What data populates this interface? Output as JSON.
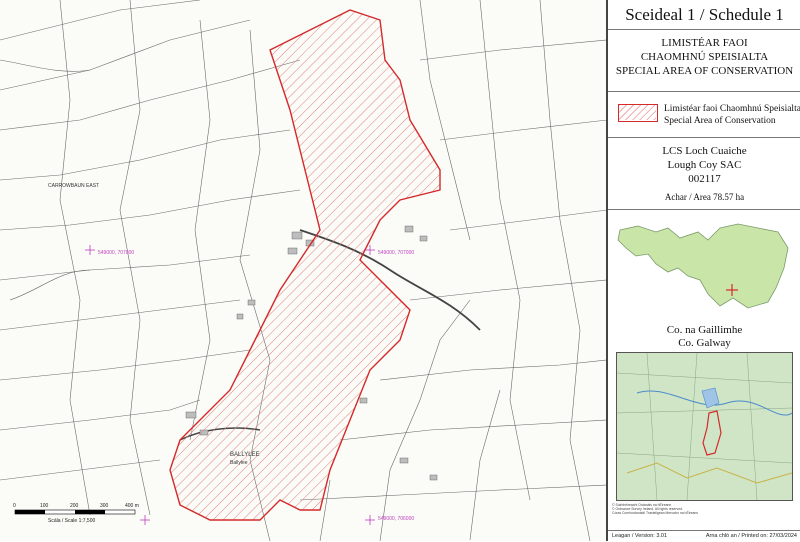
{
  "panel": {
    "title": "Sceideal 1 / Schedule 1",
    "designation_irish_1": "LIMISTÉAR FAOI",
    "designation_irish_2": "CHAOMHNÚ SPEISIALTA",
    "designation_english": "SPECIAL AREA OF CONSERVATION",
    "legend_irish": "Limistéar faoi Chaomhnú Speisialta",
    "legend_english": "Special Area of Conservation",
    "site_irish": "LCS Loch Cuaiche",
    "site_english": "Lough Coy SAC",
    "site_code": "002117",
    "area_text": "Achar / Area 78.57 ha",
    "county_irish": "Co. na Gaillimhe",
    "county_english": "Co. Galway",
    "copyright_line_1": "© Suirbhéireacht Ordanáis na hÉireann",
    "copyright_line_2": "© Ordnance Survey Ireland. All rights reserved.",
    "copyright_line_3": "Córas Comhordanáidí Trasteilgean Mercator na hÉireann",
    "version_text": "Leagan / Version: 3.01",
    "printed_text": "Arna chló an / Printed on: 27/03/2024"
  },
  "map": {
    "townland_label_1": "CARROWBAUN EAST",
    "townland_label_2": "BALLYLEE",
    "townland_label_3": "Ballylee",
    "grid_label_1": "549000, 707000",
    "grid_label_2": "549000, 707000",
    "grid_label_3": "549000, 706000",
    "scale_text": "Scála / Scale 1:7,500",
    "scale_ticks": [
      "0",
      "100",
      "200",
      "300",
      "400 m"
    ],
    "colors": {
      "boundary": "#d42a2a",
      "fields": "#555555",
      "grid": "#c040c0",
      "county_fill": "#c9e6a8",
      "locator_marker": "#d42a2a"
    }
  }
}
